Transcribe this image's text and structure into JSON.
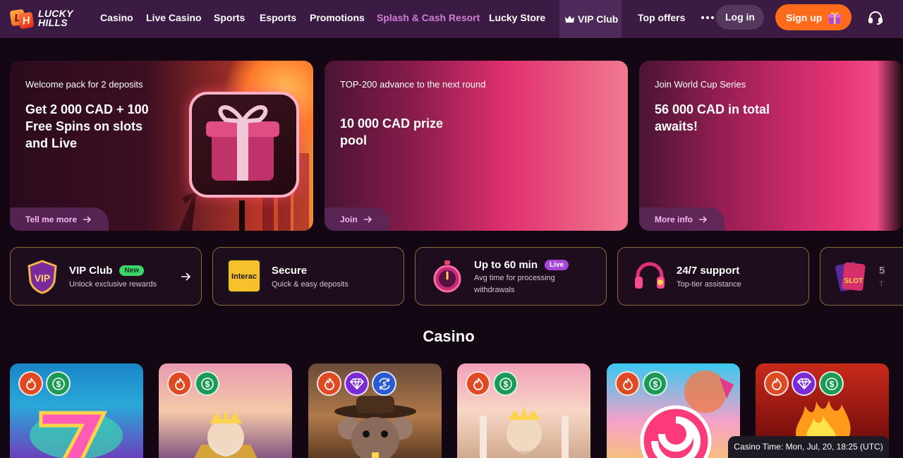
{
  "brand": {
    "line1": "LUCKY",
    "line2": "HILLS",
    "mark_letters": [
      "L",
      "H"
    ]
  },
  "nav": {
    "items": [
      {
        "label": "Casino"
      },
      {
        "label": "Live Casino"
      },
      {
        "label": "Sports"
      },
      {
        "label": "Esports"
      },
      {
        "label": "Promotions"
      },
      {
        "label": "Splash & Cash Resort"
      },
      {
        "label": "Lucky Store"
      },
      {
        "label": "VIP Club",
        "icon": "crown-icon"
      },
      {
        "label": "Top offers"
      }
    ],
    "more_icon": "more-dots-icon",
    "login_label": "Log in",
    "signup_label": "Sign up",
    "support_icon": "headset-icon"
  },
  "banners": [
    {
      "eyebrow": "Welcome pack for 2 deposits",
      "headline": "Get  2 000 CAD  + 100 Free Spins on slots and Live",
      "cta": "Tell me more"
    },
    {
      "eyebrow": "TOP-200 advance to the next round",
      "headline": "10 000 CAD prize pool",
      "cta": "Join"
    },
    {
      "eyebrow": "Join World Cup Series",
      "headline": "56 000 CAD in total awaits!",
      "cta": "More info"
    }
  ],
  "features": [
    {
      "title": "VIP Club",
      "badge": "New",
      "subtitle": "Unlock exclusive rewards",
      "icon": "vip-shield-icon"
    },
    {
      "title": "Secure",
      "subtitle": "Quick & easy deposits",
      "icon": "interac-icon",
      "icon_text": "Interac"
    },
    {
      "title": "Up to 60 min",
      "badge": "Live",
      "subtitle": "Avg time for processing withdrawals",
      "icon": "stopwatch-icon"
    },
    {
      "title": "24/7 support",
      "subtitle": "Top-tier assistance",
      "icon": "headphones-icon"
    },
    {
      "title": "5",
      "subtitle": "T",
      "icon": "slot-cards-icon",
      "icon_text": "SLOT"
    }
  ],
  "section": {
    "title": "Casino"
  },
  "games": [
    {
      "tags": [
        "fire-icon",
        "cash-icon"
      ]
    },
    {
      "tags": [
        "fire-icon",
        "cash-icon"
      ]
    },
    {
      "tags": [
        "fire-icon",
        "gem-icon",
        "swap-cash-icon"
      ]
    },
    {
      "tags": [
        "fire-icon",
        "cash-icon"
      ]
    },
    {
      "tags": [
        "fire-icon",
        "cash-icon"
      ]
    },
    {
      "tags": [
        "fire-icon",
        "gem-icon",
        "cash-icon"
      ]
    }
  ],
  "casino_time": "Casino Time: Mon, Jul, 20, 18:25 (UTC)",
  "colors": {
    "header_bg": "#3b1b44",
    "page_bg": "#140714",
    "signup": "#ff6b1a",
    "splash_link": "#d07dd6",
    "feature_border": "#8a6a3d"
  }
}
